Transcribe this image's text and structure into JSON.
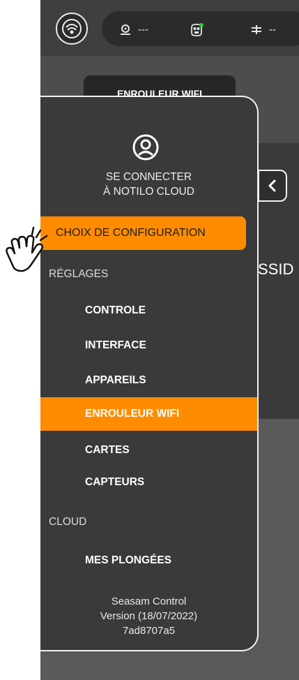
{
  "topbar": {
    "stats": [
      {
        "icon": "winch-depth-icon",
        "value": "---"
      },
      {
        "icon": "robot-mask-icon",
        "value": ""
      },
      {
        "icon": "heading-icon",
        "value": "--"
      }
    ]
  },
  "background": {
    "tab_label": "ENROULEUR WIFI",
    "ssid_label": "SSID"
  },
  "drawer": {
    "connect_line1": "SE CONNECTER",
    "connect_line2": "À NOTILO CLOUD",
    "choix_label": "CHOIX DE CONFIGURATION",
    "reglages_label": "RÉGLAGES",
    "items": [
      {
        "label": "CONTROLE"
      },
      {
        "label": "INTERFACE"
      },
      {
        "label": "APPAREILS"
      },
      {
        "label": "ENROULEUR WIFI",
        "active": true
      },
      {
        "label": "CARTES"
      },
      {
        "label": "CAPTEURS"
      }
    ],
    "cloud_label": "CLOUD",
    "cloud_items": [
      {
        "label": "MES PLONGÉES"
      }
    ],
    "footer": {
      "app_name": "Seasam Control",
      "version": "Version (18/07/2022)",
      "build": "7ad8707a5"
    }
  },
  "colors": {
    "accent": "#ff8c00",
    "drawer_bg": "#3a3a3a",
    "status_dot": "#2ecc40"
  }
}
